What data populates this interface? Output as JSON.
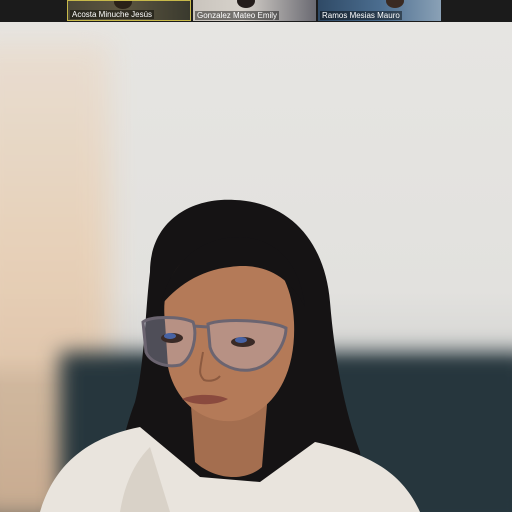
{
  "participants": [
    {
      "name": "Acosta Minuche Jesús",
      "active": true
    },
    {
      "name": "Gonzalez Mateo Emily",
      "active": false
    },
    {
      "name": "Ramos Mesias Mauro",
      "active": false
    }
  ],
  "colors": {
    "active_speaker_border": "#c7b94a",
    "strip_background": "#1b1b1b",
    "name_label_text": "#ffffff"
  },
  "icons": [
    "participant-video-thumbnail",
    "speaker-video"
  ]
}
